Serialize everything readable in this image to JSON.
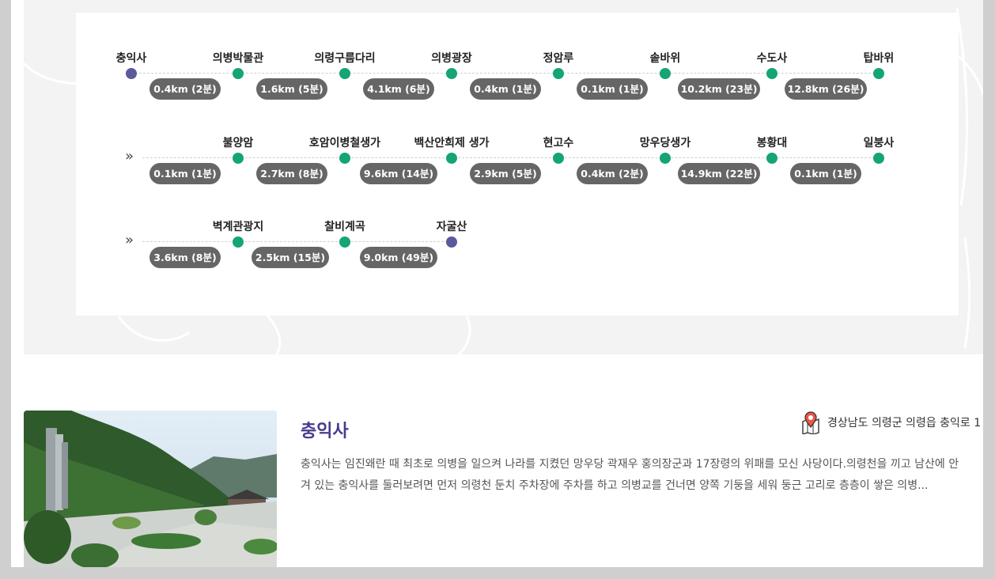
{
  "route": {
    "rows": [
      {
        "continued": false,
        "stops": [
          {
            "name": "충익사",
            "terminal": true
          },
          {
            "name": "의병박물관",
            "terminal": false
          },
          {
            "name": "의령구름다리",
            "terminal": false
          },
          {
            "name": "의병광장",
            "terminal": false
          },
          {
            "name": "정암루",
            "terminal": false
          },
          {
            "name": "솥바위",
            "terminal": false
          },
          {
            "name": "수도사",
            "terminal": false
          },
          {
            "name": "탑바위",
            "terminal": false
          }
        ],
        "segments": [
          "0.4km (2분)",
          "1.6km (5분)",
          "4.1km (6분)",
          "0.4km (1분)",
          "0.1km (1분)",
          "10.2km (23분)",
          "12.8km (26분)"
        ]
      },
      {
        "continued": true,
        "stops": [
          {
            "name": "불양암",
            "terminal": false
          },
          {
            "name": "호암이병철생가",
            "terminal": false
          },
          {
            "name": "백산안희제 생가",
            "terminal": false
          },
          {
            "name": "현고수",
            "terminal": false
          },
          {
            "name": "망우당생가",
            "terminal": false
          },
          {
            "name": "봉황대",
            "terminal": false
          },
          {
            "name": "일붕사",
            "terminal": false
          }
        ],
        "segments": [
          "0.1km (1분)",
          "2.7km (8분)",
          "9.6km (14분)",
          "2.9km (5분)",
          "0.4km (2분)",
          "14.9km (22분)",
          "0.1km (1분)"
        ]
      },
      {
        "continued": true,
        "stops": [
          {
            "name": "벽계관광지",
            "terminal": false
          },
          {
            "name": "찰비계곡",
            "terminal": false
          },
          {
            "name": "자굴산",
            "terminal": true
          }
        ],
        "segments": [
          "3.6km (8분)",
          "2.5km (15분)",
          "9.0km (49분)"
        ]
      }
    ],
    "continue_glyph": "»",
    "colors": {
      "stop": "#14a572",
      "terminal": "#5b5a9c",
      "pill": "#666666"
    }
  },
  "detail": {
    "title": "충익사",
    "address": "경상남도 의령군 의령읍 충익로 1",
    "address_icon": "map-pin-icon",
    "description_lines": [
      "충익사는 임진왜란 때 최초로 의병을 일으켜 나라를 지켰던 망우당 곽재우 홍의장군과 17장령의 위패를 모신 사당이다.의령천을 끼고 남산에 안",
      "겨 있는 충익사를 둘러보려면 먼저 의령천 둔치 주차장에 주차를 하고 의병교를 건너면 양쪽 기둥을 세워 둥근 고리로 층층이 쌓은 의병..."
    ],
    "title_color": "#4a3a8e"
  }
}
